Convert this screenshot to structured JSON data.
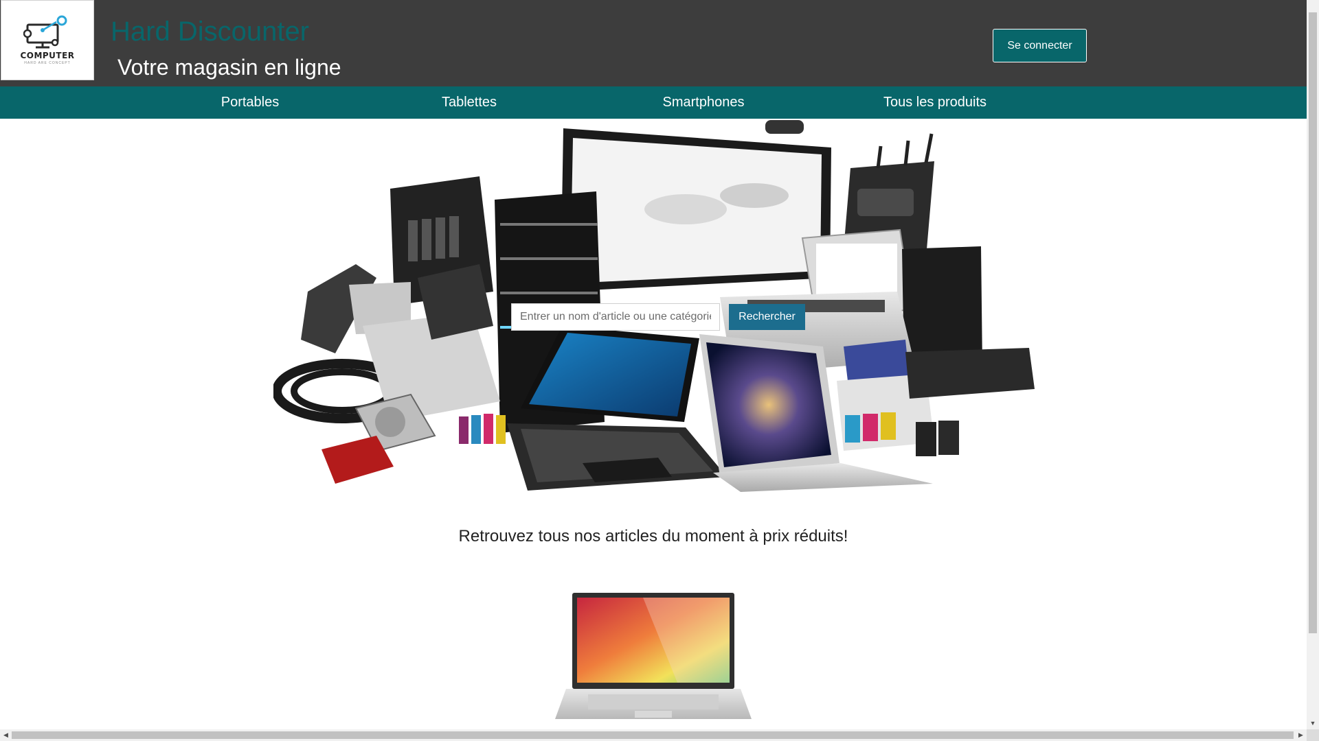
{
  "header": {
    "logo_word": "COMPUTER",
    "logo_tagline": "HARD ARE CONCEPT",
    "title": "Hard Discounter",
    "subtitle": "Votre magasin en ligne",
    "login_label": "Se connecter"
  },
  "nav": {
    "items": [
      {
        "label": "Portables"
      },
      {
        "label": "Tablettes"
      },
      {
        "label": "Smartphones"
      },
      {
        "label": "Tous les produits"
      }
    ]
  },
  "search": {
    "placeholder": "Entrer un nom d'article ou une catégorie",
    "value": "",
    "button_label": "Rechercher"
  },
  "promo": {
    "text": "Retrouvez tous nos articles du moment à prix réduits!"
  },
  "colors": {
    "header_bg": "#3d3d3d",
    "accent_teal": "#08666a",
    "search_button": "#1c6d8e"
  },
  "icons": {
    "logo": "computer-gear-icon",
    "scroll_down": "triangle-down-icon",
    "scroll_left": "triangle-left-icon",
    "scroll_right": "triangle-right-icon"
  }
}
